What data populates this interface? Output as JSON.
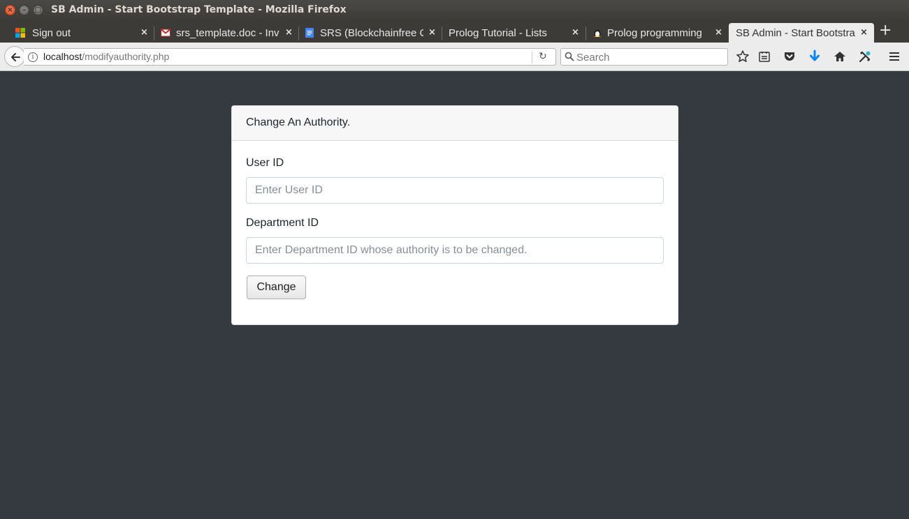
{
  "window": {
    "title": "SB Admin - Start Bootstrap Template - Mozilla Firefox",
    "close_glyph": "×",
    "min_glyph": "–",
    "max_glyph": "□"
  },
  "tabs": [
    {
      "label": "Sign out",
      "icon": "microsoft-logo-icon",
      "active": false
    },
    {
      "label": "srs_template.doc - Inv",
      "icon": "gmail-icon",
      "active": false
    },
    {
      "label": "SRS (Blockchainfree C",
      "icon": "google-docs-icon",
      "active": false
    },
    {
      "label": "Prolog Tutorial - Lists",
      "icon": "",
      "active": false
    },
    {
      "label": "Prolog programming",
      "icon": "linux-penguin-icon",
      "active": false
    },
    {
      "label": "SB Admin - Start Bootstra",
      "icon": "",
      "active": true
    }
  ],
  "tab_close_glyph": "×",
  "new_tab_glyph": "+",
  "navbar": {
    "url_host": "localhost",
    "url_path": "/modifyauthority.php",
    "info_glyph": "i",
    "reload_glyph": "↻",
    "search_placeholder": "Search"
  },
  "card": {
    "header": "Change An Authority.",
    "user_id_label": "User ID",
    "user_id_placeholder": "Enter User ID",
    "department_label": "Department ID",
    "department_placeholder": "Enter Department ID whose authority is to be changed.",
    "button_label": "Change"
  },
  "colors": {
    "page_background": "#343a40",
    "download_arrow": "#0a84ff"
  }
}
